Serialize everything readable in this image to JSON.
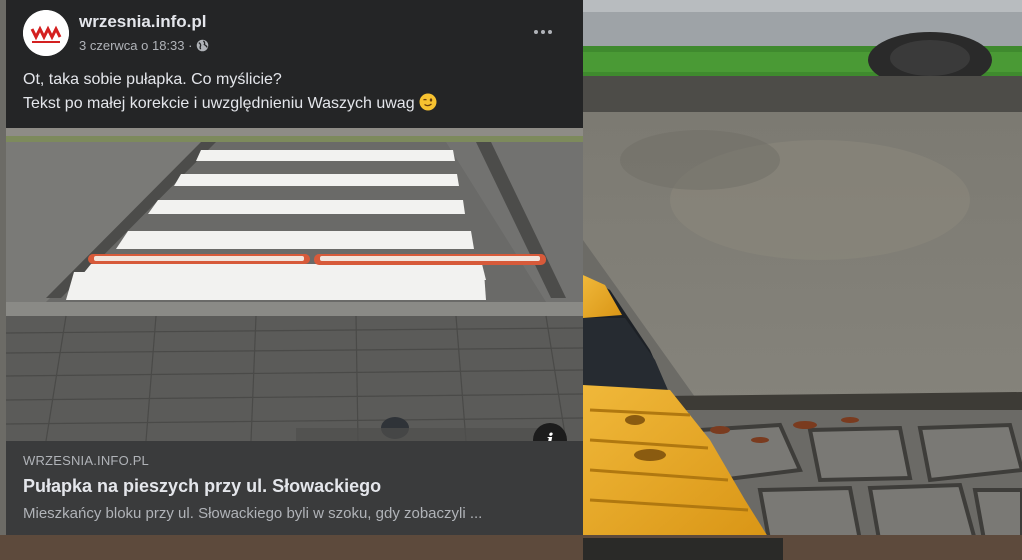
{
  "post": {
    "page_name": "wrzesnia.info.pl",
    "timestamp": "3 czerwca o 18:33 ·",
    "privacy_icon": "globe-icon",
    "more_icon": "more-dots-icon",
    "text_line1": "Ot, taka sobie pułapka. Co myślicie?",
    "text_line2": "Tekst po małej korekcie i uwzględnieniu Waszych uwag",
    "emoji": "winking-face-emoji",
    "info_icon": "i"
  },
  "link_preview": {
    "domain": "WRZESNIA.INFO.PL",
    "title": "Pułapka na pieszych przy ul. Słowackiego",
    "description": "Mieszkańcy bloku przy ul. Słowackiego byli w szoku, gdy zobaczyli ..."
  },
  "colors": {
    "card_bg": "#242526",
    "link_bg": "#3a3b3c",
    "primary_text": "#e4e6eb",
    "secondary_text": "#b0b3b8",
    "bump_yellow": "#e8a91e",
    "logo_red": "#d42020"
  }
}
